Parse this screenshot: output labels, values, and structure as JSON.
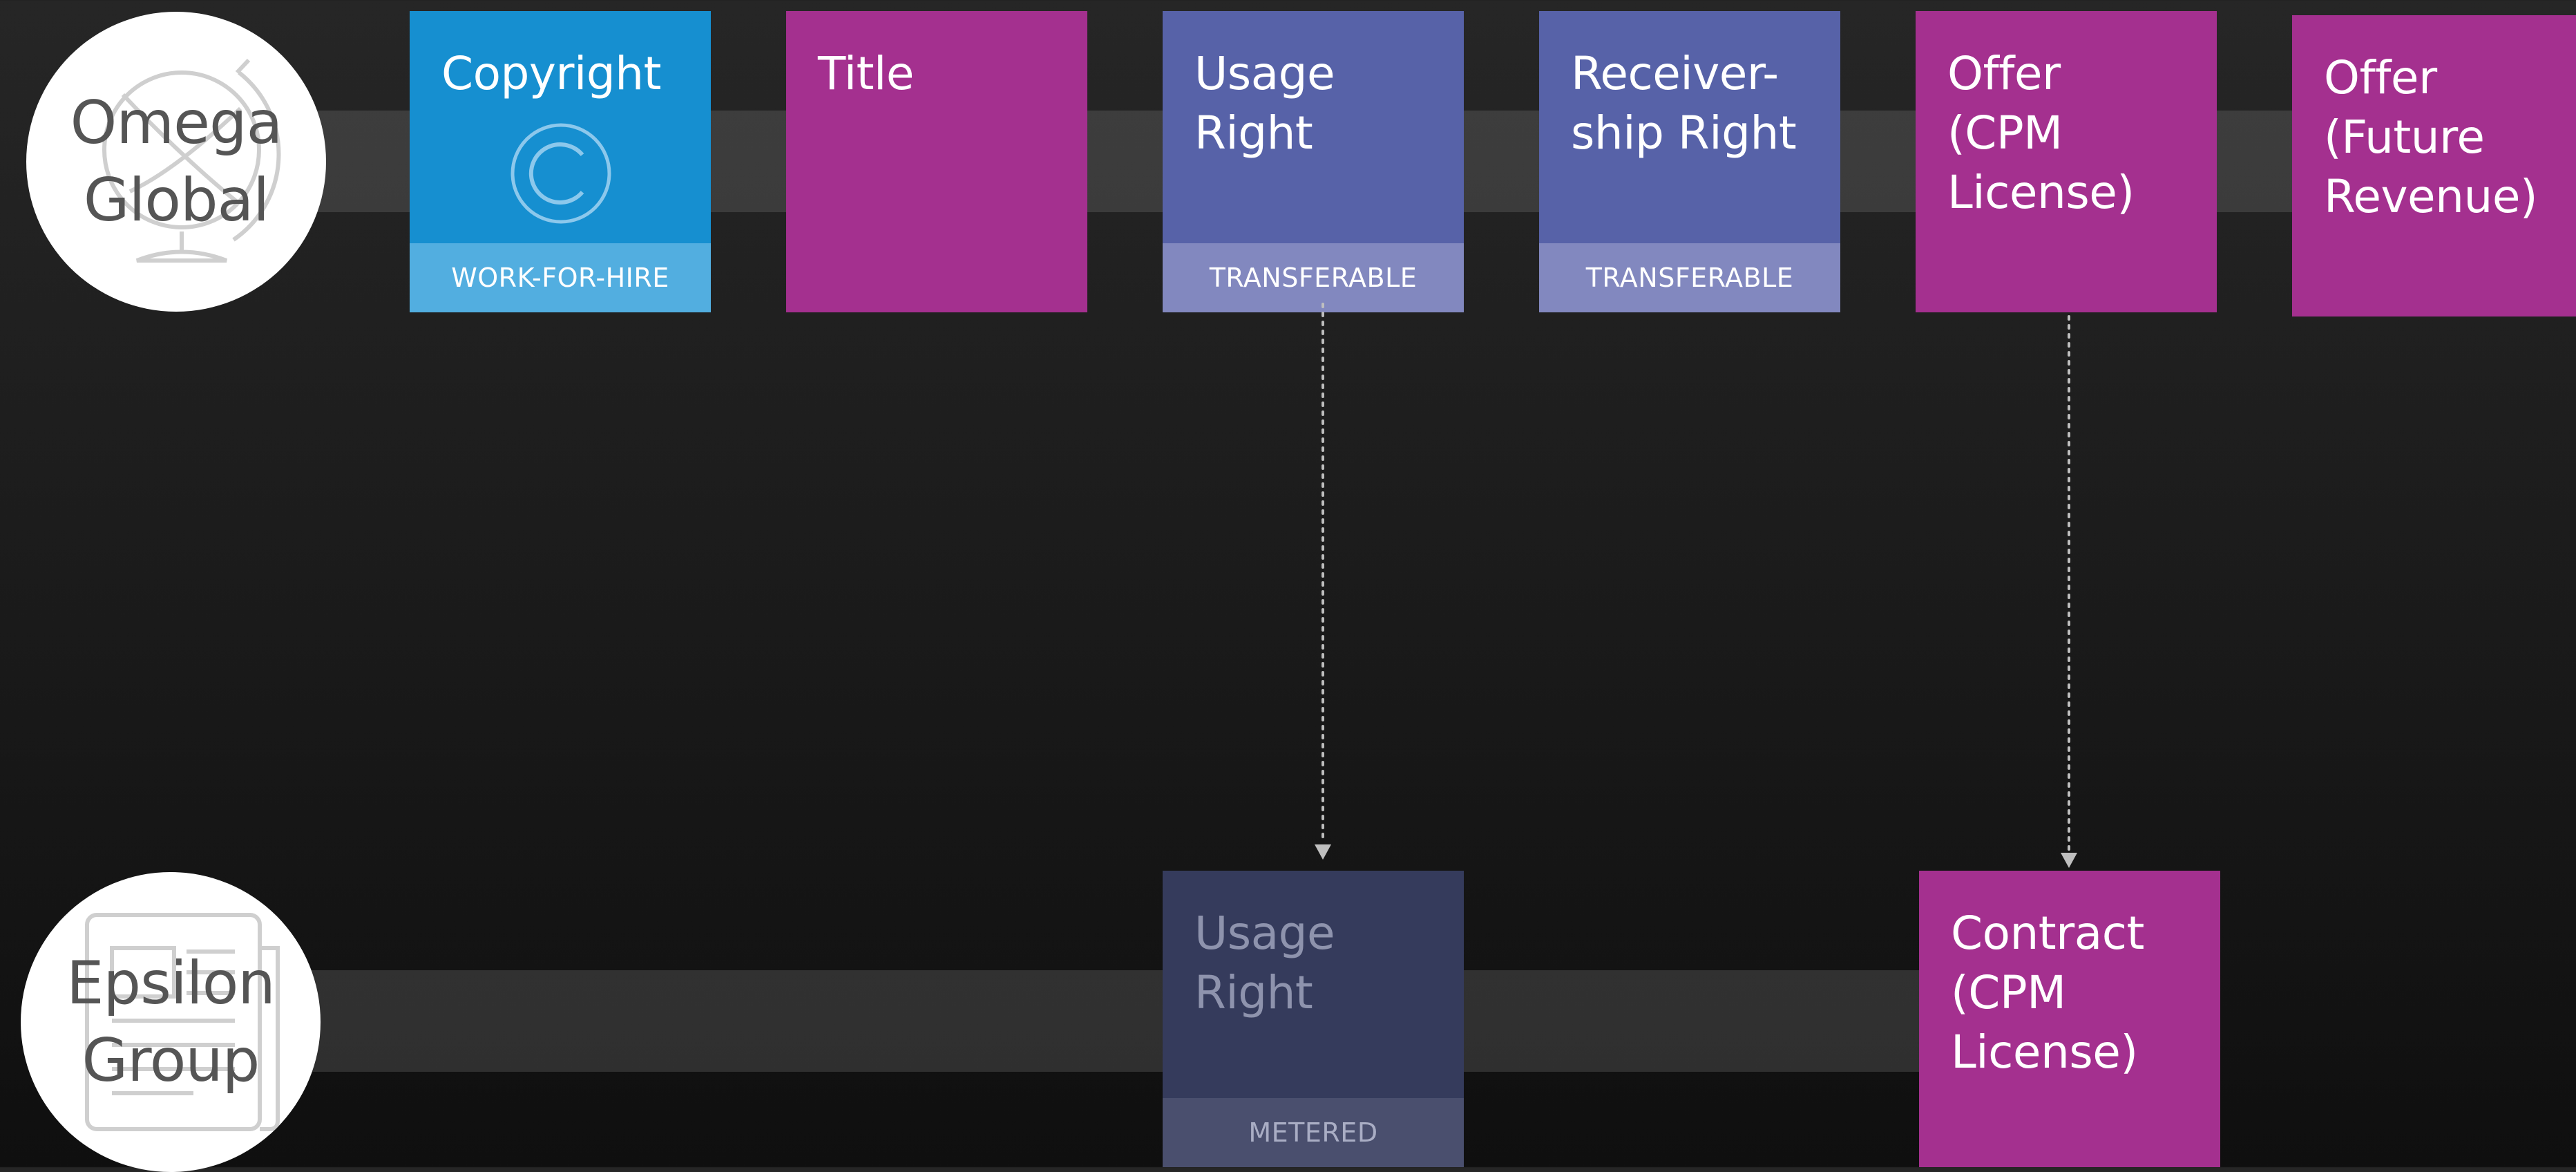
{
  "colors": {
    "background": "#1a1a1a",
    "band": "#4a4a4a",
    "entity_fill": "#ffffff",
    "entity_text": "#555555",
    "entity_icon": "#cfcfcf",
    "copyright_blue": "#168fd0",
    "copyright_badge": "#52aee0",
    "magenta": "#a4308f",
    "indigo": "#5762a8",
    "indigo_badge": "#8288bf",
    "indigo_faded": "#353b5c",
    "indigo_faded_badge": "#4a4f6e",
    "connector": "#bfbfbf"
  },
  "entities": [
    {
      "id": "omega",
      "name": "Omega\nGlobal",
      "icon": "globe-icon"
    },
    {
      "id": "epsilon",
      "name": "Epsilon\nGroup",
      "icon": "newspaper-icon"
    }
  ],
  "tiles": {
    "copyright": {
      "title": "Copyright",
      "badge": "WORK-FOR-HIRE",
      "icon": "copyright-icon"
    },
    "title": {
      "title": "Title"
    },
    "usage_right": {
      "title": "Usage\nRight",
      "badge": "TRANSFERABLE"
    },
    "receivership_right": {
      "title": "Receiver-\nship Right",
      "badge": "TRANSFERABLE"
    },
    "offer_cpm": {
      "title": "Offer\n(CPM\nLicense)"
    },
    "offer_future": {
      "title": "Offer\n(Future\nRevenue)"
    },
    "usage_right_epsilon": {
      "title": "Usage\nRight",
      "badge": "METERED"
    },
    "contract_cpm": {
      "title": "Contract\n(CPM\nLicense)"
    }
  },
  "connectors": [
    {
      "from": "usage_right",
      "to": "usage_right_epsilon",
      "style": "dotted-arrow"
    },
    {
      "from": "offer_cpm",
      "to": "contract_cpm",
      "style": "dotted-arrow"
    }
  ]
}
